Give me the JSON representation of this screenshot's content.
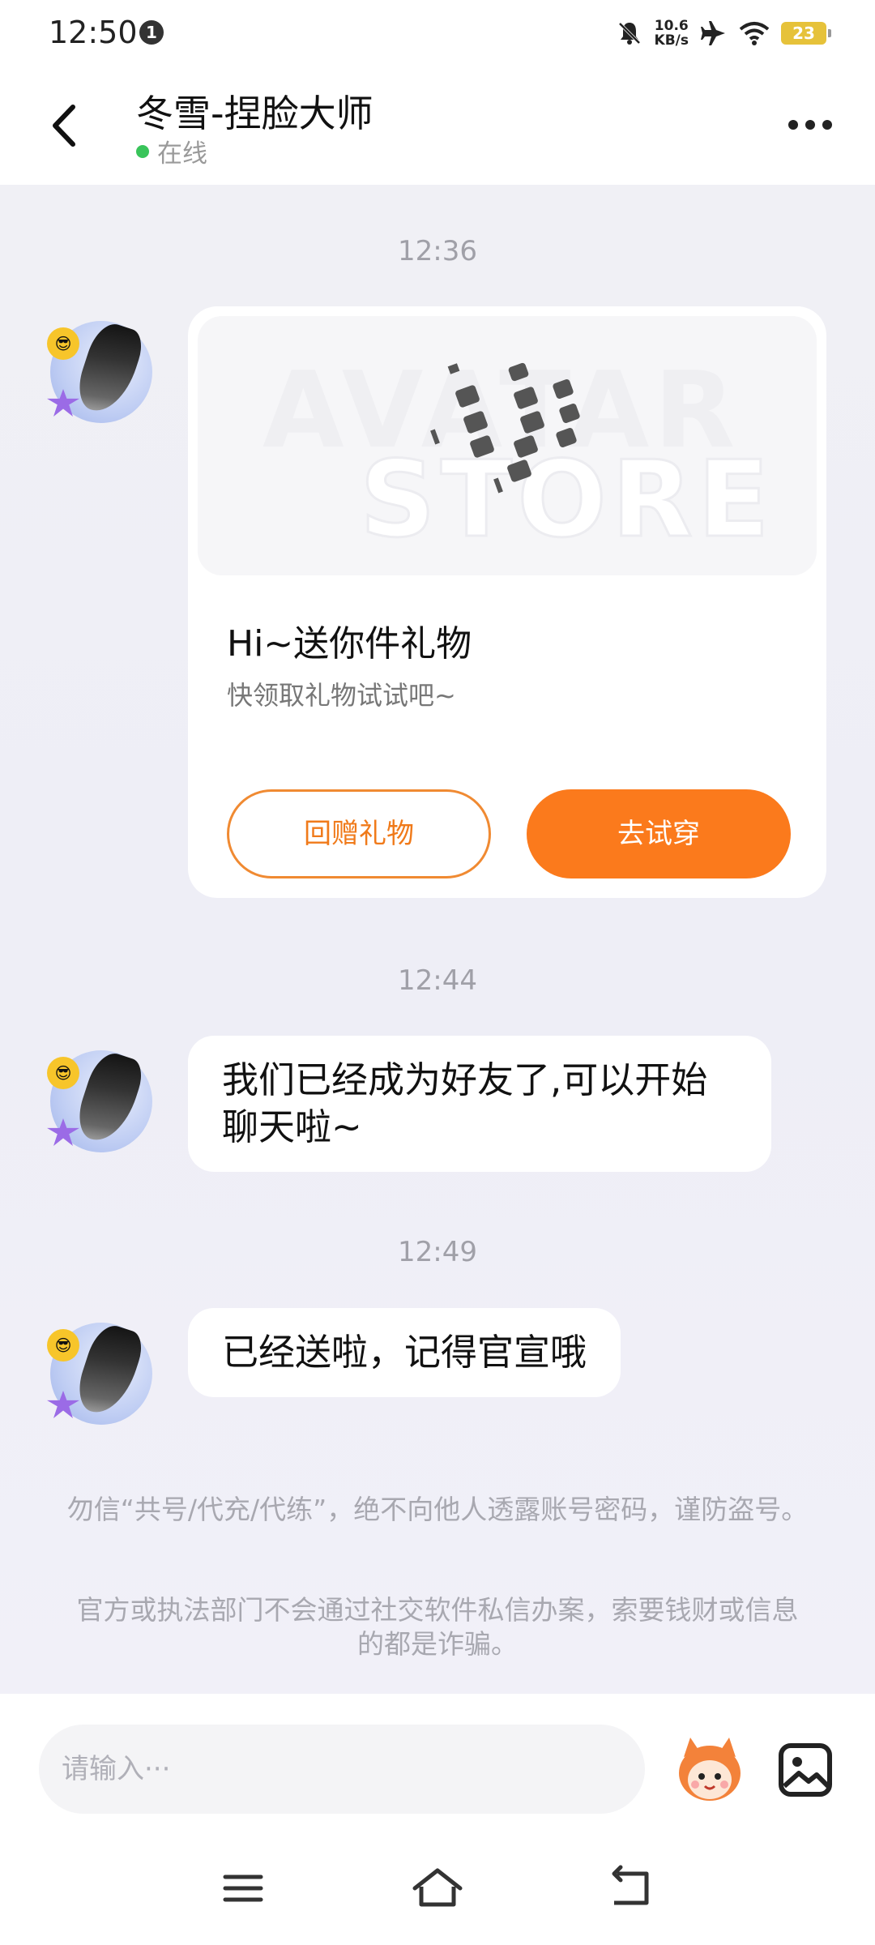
{
  "status_bar": {
    "time": "12:50",
    "notification_count": "1",
    "net_speed_value": "10.6",
    "net_speed_unit": "KB/s",
    "battery": "23"
  },
  "header": {
    "title": "冬雪-捏脸大师",
    "status": "在线"
  },
  "messages": {
    "ts1": "12:36",
    "gift": {
      "watermark_line1": "AVATAR",
      "watermark_line2": "STORE",
      "title": "Hi~送你件礼物",
      "subtitle": "快领取礼物试试吧~",
      "return_gift_label": "回赠礼物",
      "try_on_label": "去试穿"
    },
    "ts2": "12:44",
    "msg2": "我们已经成为好友了,可以开始聊天啦~",
    "ts3": "12:49",
    "msg3": "已经送啦，记得官宣哦"
  },
  "notices": {
    "notice1": "勿信“共号/代充/代练”，绝不向他人透露账号密码，谨防盗号。",
    "notice2": "官方或执法部门不会通过社交软件私信办案，索要钱财或信息的都是诈骗。"
  },
  "input": {
    "placeholder": "请输入···"
  },
  "colors": {
    "accent": "#fb7a1c",
    "online": "#39c45a",
    "chat_bg": "#f0f0f5"
  },
  "icons": {
    "back": "back-arrow-icon",
    "more": "more-icon",
    "mascot": "mascot-icon",
    "image": "image-icon",
    "menu": "menu-icon",
    "home": "home-icon",
    "return": "return-icon"
  }
}
